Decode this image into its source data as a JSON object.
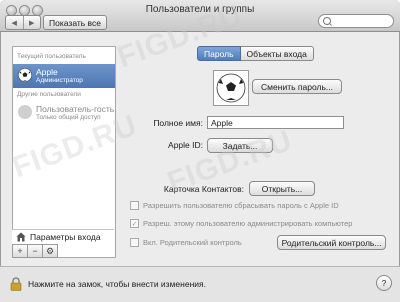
{
  "window": {
    "title": "Пользователи и группы",
    "show_all": "Показать все",
    "nav_back": "◀",
    "nav_forward": "▶"
  },
  "sidebar": {
    "current_header": "Текущий пользователь",
    "current_user": {
      "name": "Apple",
      "role": "Администратор"
    },
    "other_header": "Другие пользователи",
    "guest_user": {
      "name": "Пользователь-гость",
      "role": "Только общий доступ"
    },
    "login_options": "Параметры входа",
    "add": "+",
    "remove": "−",
    "gear": "⚙"
  },
  "tabs": [
    {
      "label": "Пароль"
    },
    {
      "label": "Объекты входа"
    }
  ],
  "main": {
    "change_password": "Сменить пароль...",
    "full_name_label": "Полное имя:",
    "full_name_value": "Apple",
    "apple_id_label": "Apple ID:",
    "apple_id_button": "Задать...",
    "contacts_label": "Карточка Контактов:",
    "open_button": "Открыть...",
    "check_reset": "Разрешить пользователю сбрасывать пароль с Apple ID",
    "check_admin": "Разреш. этому пользователю администрировать компьютер",
    "check_parental": "Вкл. Родительский контроль",
    "parental_button": "Родительский контроль..."
  },
  "footer": {
    "lock_text": "Нажмите на замок, чтобы внести изменения.",
    "help": "?"
  },
  "watermark": "FIGD.RU"
}
